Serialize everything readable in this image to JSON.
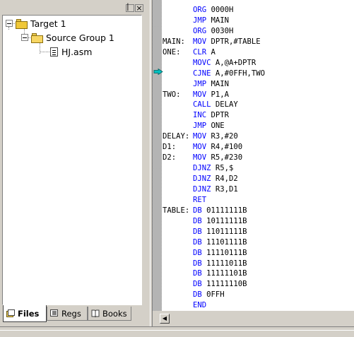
{
  "project_pane": {
    "tree": [
      {
        "label": "Target 1",
        "icon": "target-folder-icon"
      },
      {
        "label": "Source Group 1",
        "icon": "folder-icon"
      },
      {
        "label": "HJ.asm",
        "icon": "asm-file-icon"
      }
    ],
    "tabs": [
      {
        "label": "Files",
        "icon": "files-icon",
        "active": true
      },
      {
        "label": "Regs",
        "icon": "regs-icon",
        "active": false
      },
      {
        "label": "Books",
        "icon": "books-icon",
        "active": false
      }
    ],
    "close_glyph": "×"
  },
  "editor": {
    "current_line_index": 6,
    "current_line_marker": "arrow-icon",
    "lines": [
      {
        "label": "",
        "mnemonic": "ORG",
        "operands": "0000H"
      },
      {
        "label": "",
        "mnemonic": "JMP",
        "operands": "MAIN"
      },
      {
        "label": "",
        "mnemonic": "ORG",
        "operands": "0030H"
      },
      {
        "label": "MAIN:",
        "mnemonic": "MOV",
        "operands": "DPTR,#TABLE"
      },
      {
        "label": "ONE:",
        "mnemonic": "CLR",
        "operands": "A"
      },
      {
        "label": "",
        "mnemonic": "MOVC",
        "operands": "A,@A+DPTR"
      },
      {
        "label": "",
        "mnemonic": "CJNE",
        "operands": "A,#0FFH,TWO"
      },
      {
        "label": "",
        "mnemonic": "JMP",
        "operands": "MAIN"
      },
      {
        "label": "TWO:",
        "mnemonic": "MOV",
        "operands": "P1,A"
      },
      {
        "label": "",
        "mnemonic": "CALL",
        "operands": "DELAY"
      },
      {
        "label": "",
        "mnemonic": "INC",
        "operands": "DPTR"
      },
      {
        "label": "",
        "mnemonic": "JMP",
        "operands": "ONE"
      },
      {
        "label": "DELAY:",
        "mnemonic": "MOV",
        "operands": "R3,#20"
      },
      {
        "label": "D1:",
        "mnemonic": "MOV",
        "operands": "R4,#100"
      },
      {
        "label": "D2:",
        "mnemonic": "MOV",
        "operands": "R5,#230"
      },
      {
        "label": "",
        "mnemonic": "DJNZ",
        "operands": "R5,$"
      },
      {
        "label": "",
        "mnemonic": "DJNZ",
        "operands": "R4,D2"
      },
      {
        "label": "",
        "mnemonic": "DJNZ",
        "operands": "R3,D1"
      },
      {
        "label": "",
        "mnemonic": "RET",
        "operands": ""
      },
      {
        "label": "TABLE:",
        "mnemonic": "DB",
        "operands": "01111111B"
      },
      {
        "label": "",
        "mnemonic": "DB",
        "operands": "10111111B"
      },
      {
        "label": "",
        "mnemonic": "DB",
        "operands": "11011111B"
      },
      {
        "label": "",
        "mnemonic": "DB",
        "operands": "11101111B"
      },
      {
        "label": "",
        "mnemonic": "DB",
        "operands": "11110111B"
      },
      {
        "label": "",
        "mnemonic": "DB",
        "operands": "11111011B"
      },
      {
        "label": "",
        "mnemonic": "DB",
        "operands": "11111101B"
      },
      {
        "label": "",
        "mnemonic": "DB",
        "operands": "11111110B"
      },
      {
        "label": "",
        "mnemonic": "DB",
        "operands": "0FFH"
      },
      {
        "label": "",
        "mnemonic": "END",
        "operands": ""
      }
    ]
  },
  "colors": {
    "keyword": "#0000ff",
    "window_bg": "#d4d0c8",
    "arrow_fill": "#00c0c0"
  }
}
